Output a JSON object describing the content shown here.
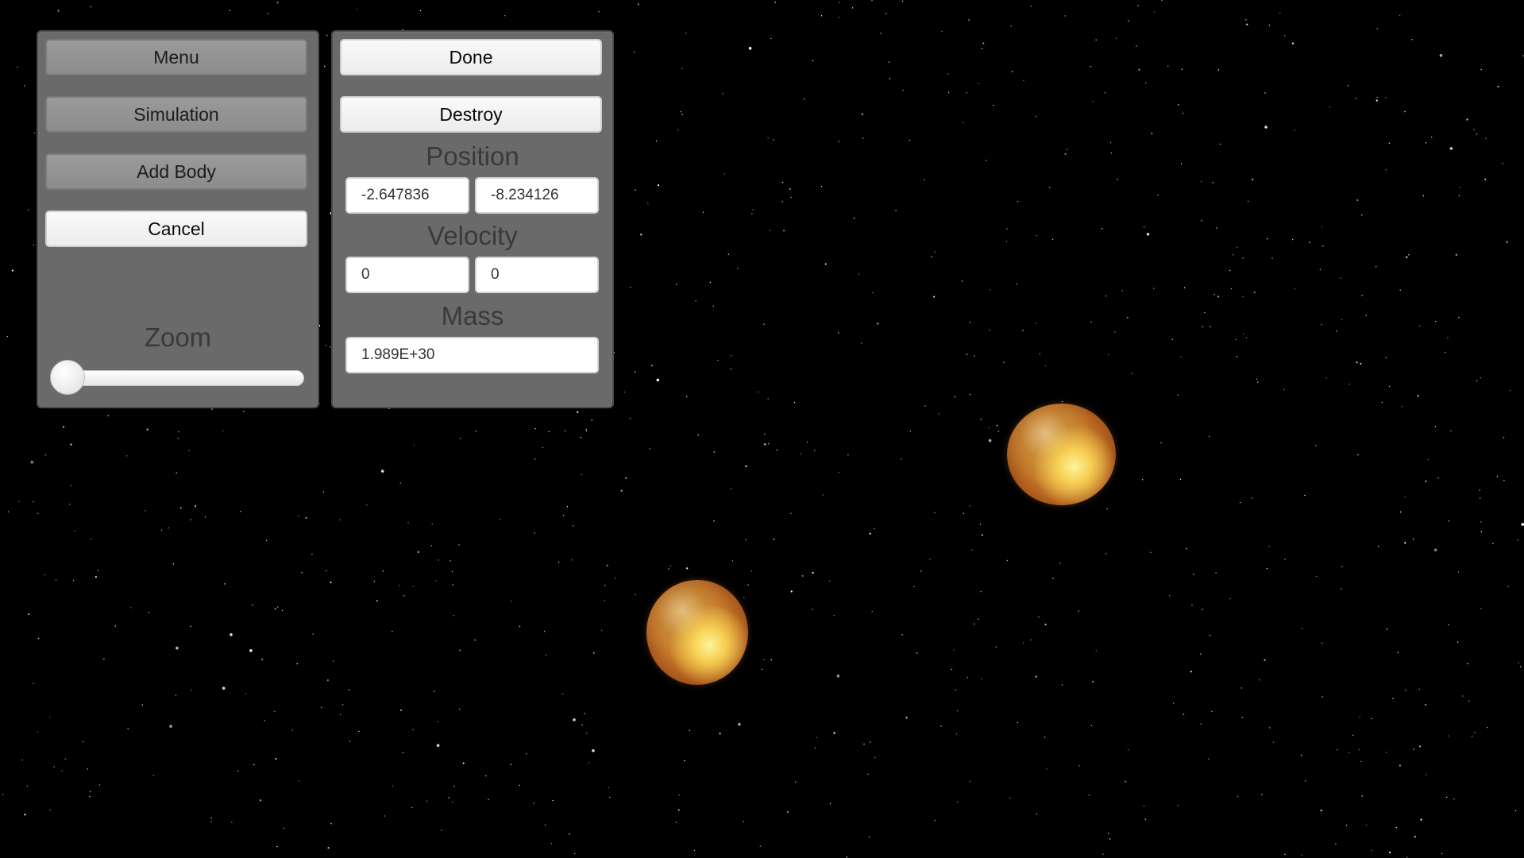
{
  "menu_panel": {
    "menu_label": "Menu",
    "simulation_label": "Simulation",
    "add_body_label": "Add Body",
    "cancel_label": "Cancel",
    "zoom_label": "Zoom",
    "zoom_level": 0
  },
  "body_editor": {
    "done_label": "Done",
    "destroy_label": "Destroy",
    "position_label": "Position",
    "position_x": "-2.647836",
    "position_y": "-8.234126",
    "velocity_label": "Velocity",
    "velocity_x": "0",
    "velocity_y": "0",
    "mass_label": "Mass",
    "mass_value": "1.989E+30"
  },
  "scene": {
    "background_color": "#000000",
    "panel_color": "#6a6a6a",
    "planet_color": "#c77a26"
  }
}
